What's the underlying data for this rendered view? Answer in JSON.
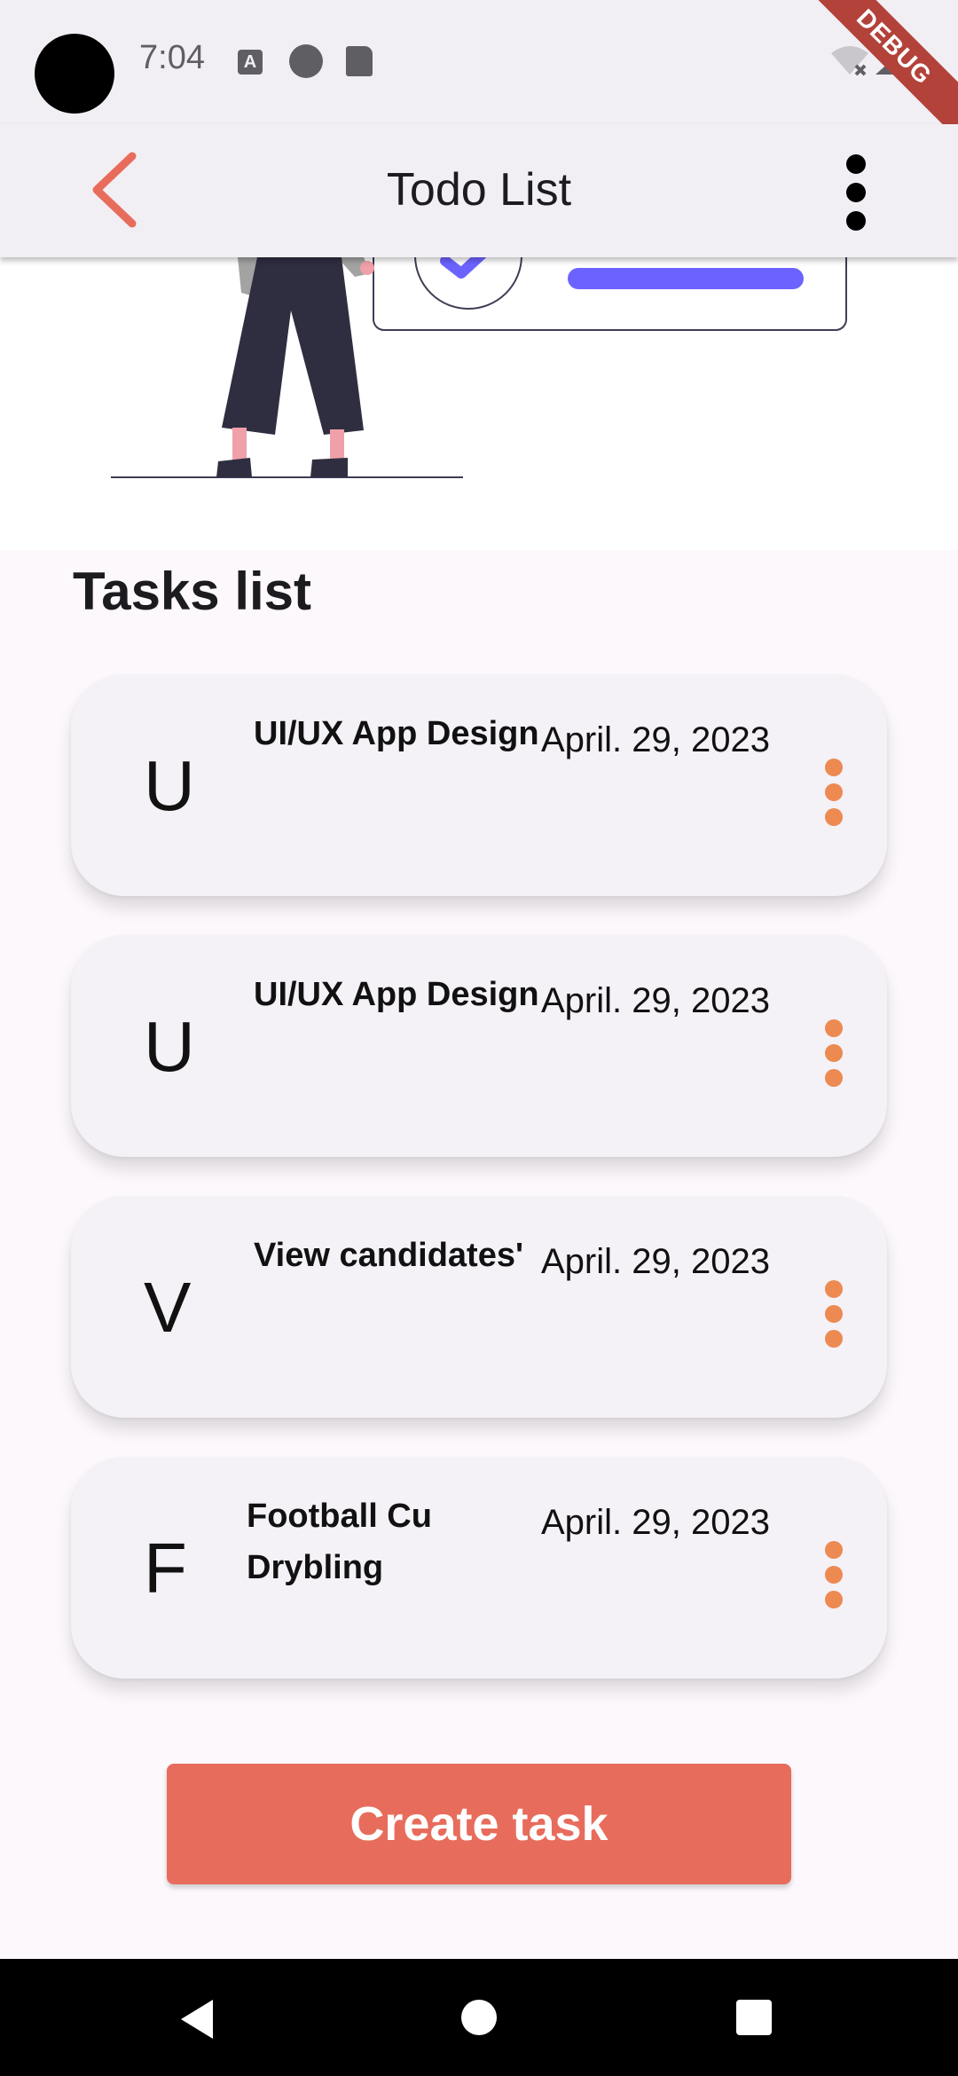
{
  "status_bar": {
    "time": "7:04",
    "icons": [
      "text-a-icon",
      "circle-app-icon",
      "sd-card-icon",
      "wifi-off-icon",
      "signal-icon"
    ],
    "debug_label": "DEBUG"
  },
  "app_bar": {
    "title": "Todo List",
    "back_icon": "chevron-left-icon",
    "menu_icon": "more-vert-icon"
  },
  "section_title": "Tasks list",
  "tasks": [
    {
      "letter": "U",
      "title": "UI/UX App Design",
      "date": "April. 29, 2023"
    },
    {
      "letter": "U",
      "title": "UI/UX App Design",
      "date": "April. 29, 2023"
    },
    {
      "letter": "V",
      "title": "View candidates'",
      "date": "April. 29, 2023"
    },
    {
      "letter": "F",
      "title": "Football Cu Drybling",
      "date": "April. 29, 2023"
    }
  ],
  "create_button_label": "Create task",
  "colors": {
    "accent": "#e86c5c",
    "dots": "#ec8a52",
    "illustration_purple": "#6c63ff"
  }
}
